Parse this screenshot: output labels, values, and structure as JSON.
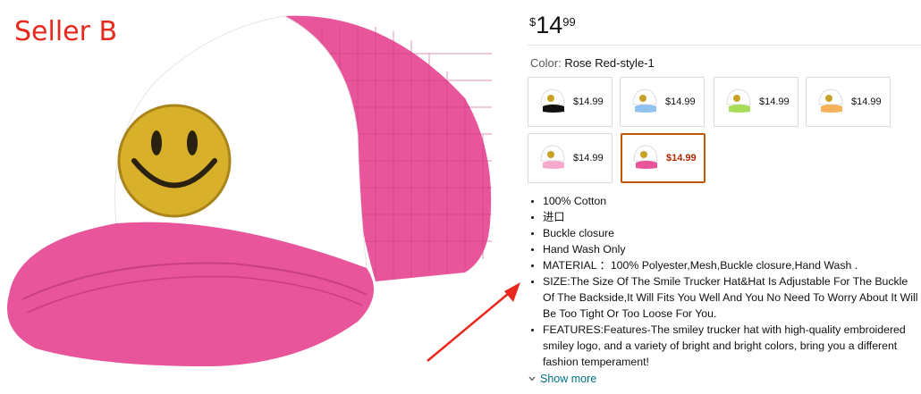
{
  "annotation": {
    "label": "Seller B",
    "color": "#e8281c"
  },
  "product": {
    "price": {
      "symbol": "$",
      "whole": "14",
      "fraction": "99"
    },
    "color_label": "Color:",
    "color_value": "Rose Red-style-1",
    "swatches": [
      {
        "name": "black",
        "icon": "black-white-cap-icon",
        "price": "$14.99",
        "selected": false
      },
      {
        "name": "blue",
        "icon": "blue-white-cap-icon",
        "price": "$14.99",
        "selected": false
      },
      {
        "name": "green",
        "icon": "green-white-cap-icon",
        "price": "$14.99",
        "selected": false
      },
      {
        "name": "orange",
        "icon": "orange-white-cap-icon",
        "price": "$14.99",
        "selected": false
      },
      {
        "name": "pink",
        "icon": "light-pink-white-cap-icon",
        "price": "$14.99",
        "selected": false
      },
      {
        "name": "rose-red",
        "icon": "rose-red-white-cap-icon",
        "price": "$14.99",
        "selected": true
      }
    ],
    "bullets": [
      "100% Cotton",
      "进口",
      "Buckle closure",
      "Hand Wash Only",
      "MATERIAL ：100% Polyester,Mesh,Buckle closure,Hand Wash .",
      "SIZE:The Size Of The Smile Trucker Hat&Hat Is Adjustable For The Buckle Of The Backside,It Will Fits You Well And You No Need To Worry About It Will Be Too Tight Or Too Loose For You.",
      "FEATURES:Features-The smiley trucker hat with high-quality embroidered smiley logo, and a variety of bright and bright colors, bring you a different fashion temperament!"
    ],
    "show_more": "Show more"
  },
  "colors": {
    "accent_link": "#007185",
    "selected_border": "#c45500",
    "deal_price": "#b12704",
    "hat_pink": "#e8559a"
  }
}
